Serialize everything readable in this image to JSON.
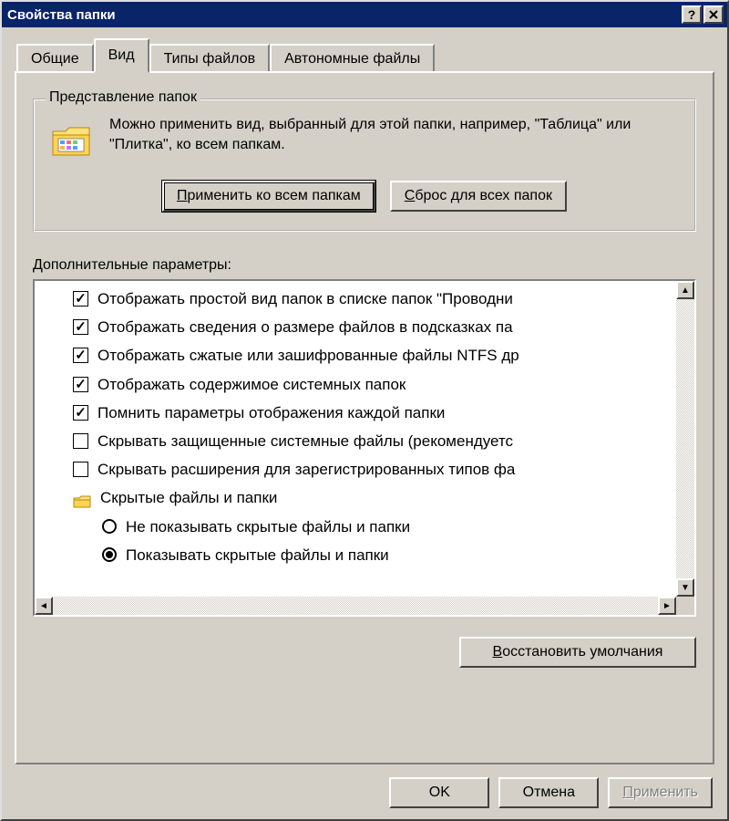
{
  "window": {
    "title": "Свойства папки"
  },
  "tabs": [
    {
      "label": "Общие",
      "active": false
    },
    {
      "label": "Вид",
      "active": true
    },
    {
      "label": "Типы файлов",
      "active": false
    },
    {
      "label": "Автономные файлы",
      "active": false
    }
  ],
  "folderViews": {
    "group_title": "Представление папок",
    "text": "Можно применить вид, выбранный для этой папки, например, \"Таблица\" или \"Плитка\", ко всем папкам.",
    "apply_btn": "Применить ко всем папкам",
    "reset_btn": "Сброс для всех папок"
  },
  "advanced": {
    "label": "Дополнительные параметры:",
    "items": [
      {
        "type": "check",
        "checked": true,
        "label": "Отображать простой вид папок в списке папок \"Проводни"
      },
      {
        "type": "check",
        "checked": true,
        "label": "Отображать сведения о размере файлов в подсказках па"
      },
      {
        "type": "check",
        "checked": true,
        "label": "Отображать сжатые или зашифрованные файлы NTFS др"
      },
      {
        "type": "check",
        "checked": true,
        "label": "Отображать содержимое системных папок"
      },
      {
        "type": "check",
        "checked": true,
        "label": "Помнить параметры отображения каждой папки"
      },
      {
        "type": "check",
        "checked": false,
        "label": "Скрывать защищенные системные файлы (рекомендуетс"
      },
      {
        "type": "check",
        "checked": false,
        "label": "Скрывать расширения для зарегистрированных типов фа"
      },
      {
        "type": "folder",
        "label": "Скрытые файлы и папки"
      },
      {
        "type": "radio",
        "checked": false,
        "indent": true,
        "label": "Не показывать скрытые файлы и папки"
      },
      {
        "type": "radio",
        "checked": true,
        "indent": true,
        "label": "Показывать скрытые файлы и папки"
      }
    ],
    "restore_btn": "Восстановить умолчания"
  },
  "dialog": {
    "ok": "OK",
    "cancel": "Отмена",
    "apply": "Применить"
  }
}
